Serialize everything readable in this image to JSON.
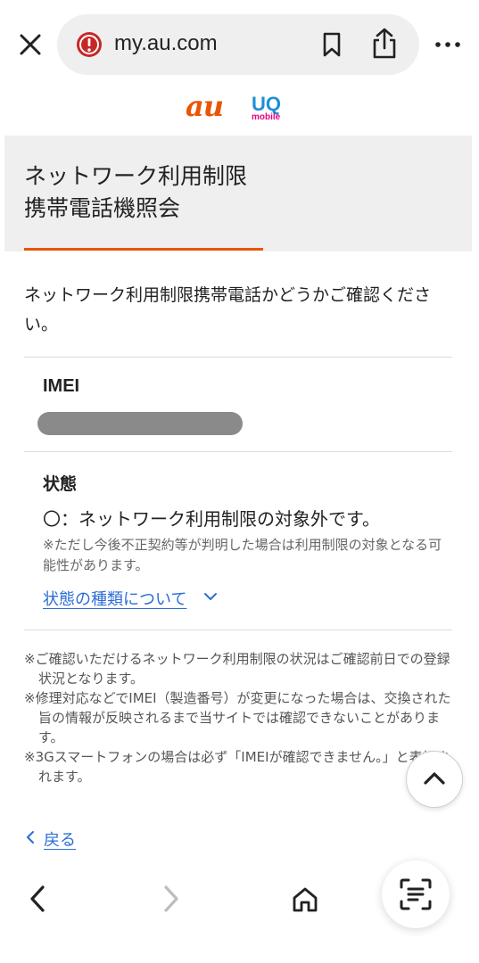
{
  "browser": {
    "url": "my.au.com",
    "close_icon": "close-icon",
    "security_icon": "alert-circle-icon",
    "bookmark_icon": "bookmark-icon",
    "share_icon": "share-icon",
    "more_icon": "more-horizontal-icon"
  },
  "logos": {
    "au": "au",
    "uq_main": "UQ",
    "uq_sub": "mobile"
  },
  "page": {
    "title_line1": "ネットワーク利用制限",
    "title_line2": "携帯電話機照会",
    "intro": "ネットワーク利用制限携帯電話かどうかご確認ください。",
    "imei_label": "IMEI",
    "status_label": "状態",
    "status_value": "〇：ネットワーク利用制限の対象外です。",
    "status_note": "※ただし今後不正契約等が判明した場合は利用制限の対象となる可能性があります。",
    "status_link": "状態の種類について",
    "footnotes": [
      "※ご確認いただけるネットワーク利用制限の状況はご確認前日での登録状況となります。",
      "※修理対応などでIMEI（製造番号）が変更になった場合は、交換された旨の情報が反映されるまで当サイトでは確認できないことがあります。",
      "※3Gスマートフォンの場合は必ず「IMEIが確認できません。」と表記されます。"
    ],
    "back_link": "戻る"
  },
  "bottom_nav": {
    "back_icon": "chevron-left-icon",
    "forward_icon": "chevron-right-icon",
    "home_icon": "home-icon",
    "scan_icon": "scan-text-icon"
  },
  "colors": {
    "accent": "#eb5505",
    "link": "#2a6dd5",
    "title_bg": "#efefef",
    "imei_mask": "#8a8a8a"
  }
}
